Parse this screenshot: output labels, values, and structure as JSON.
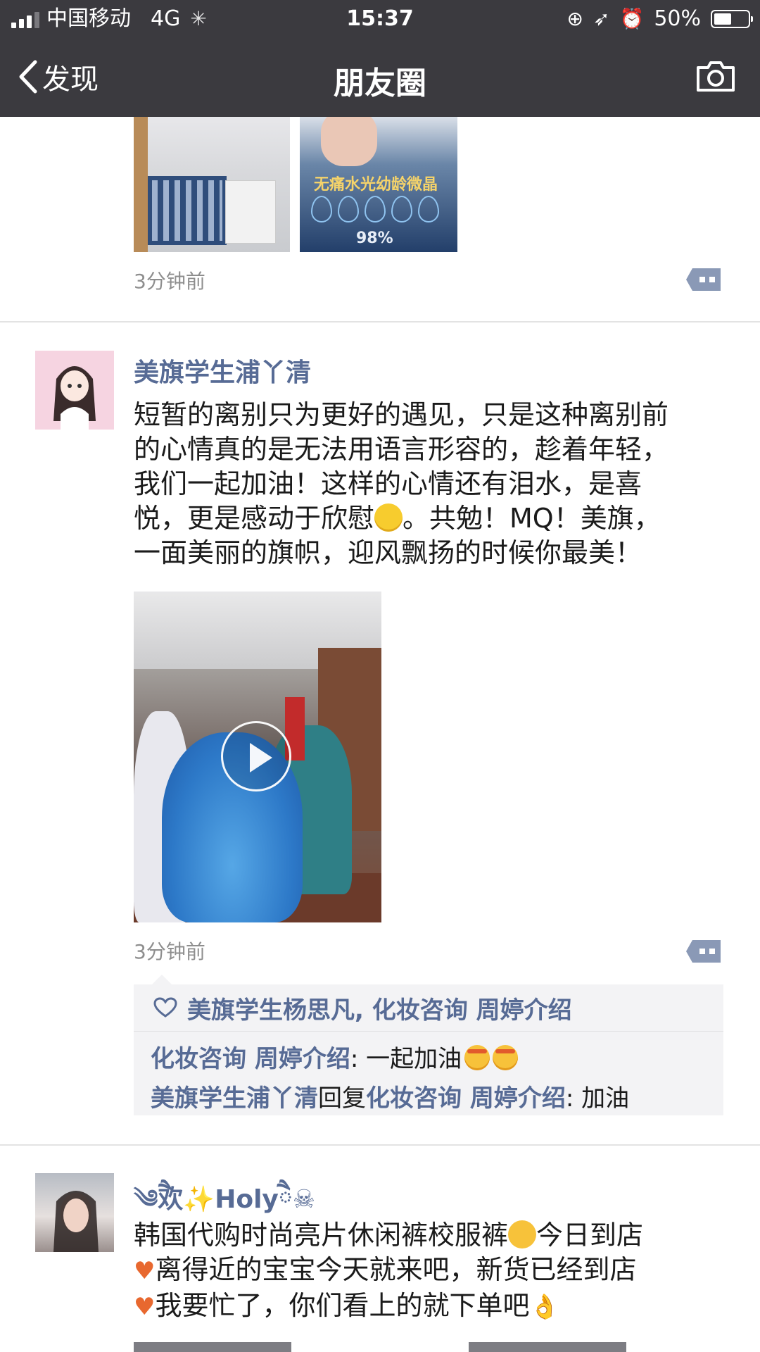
{
  "status_bar": {
    "carrier": "中国移动",
    "network": "4G",
    "time": "15:37",
    "battery": "50%",
    "battery_level": 0.5
  },
  "nav": {
    "back_label": "发现",
    "title": "朋友圈",
    "icons": [
      "chevron-left-icon",
      "camera-icon"
    ]
  },
  "posts": [
    {
      "time": "3分钟前"
    },
    {
      "author": "美旗学生浦丫清",
      "text_lines": [
        "短暂的离别只为更好的遇见，只是这种离别前",
        "的心情真的是无法用语言形容的，趁着年轻，",
        "我们一起加油！这样的心情还有泪水，是喜",
        "悦，更是感动于欣慰",
        "。共勉！MQ！美旗，",
        "一面美丽的旗帜，迎风飘扬的时候你最美！"
      ],
      "time": "3分钟前",
      "likes": "美旗学生杨思凡, 化妆咨询 周婷介绍",
      "comments": [
        {
          "author": "化妆咨询 周婷介绍",
          "text": ": 一起加油"
        },
        {
          "author": "美旗学生浦丫清",
          "reply_word": "回复",
          "target": "化妆咨询 周婷介绍",
          "text": ": 加油"
        }
      ]
    },
    {
      "author_prefix": "༄ཻ欢",
      "author_sparkle": "✨",
      "author_name": "Holy",
      "author_suffix": "ཻ☠",
      "text_lines": [
        "韩国代购时尚亮片休闲裤校服裤",
        "今日到店",
        "离得近的宝宝今天就来吧，新货已经到店",
        "我要忙了，你们看上的就下单吧"
      ]
    }
  ],
  "colors": {
    "nav_background": "#3b3a3f",
    "link_blue": "#576b95",
    "time_gray": "#8e8e8e",
    "comment_background": "#f3f3f5"
  }
}
